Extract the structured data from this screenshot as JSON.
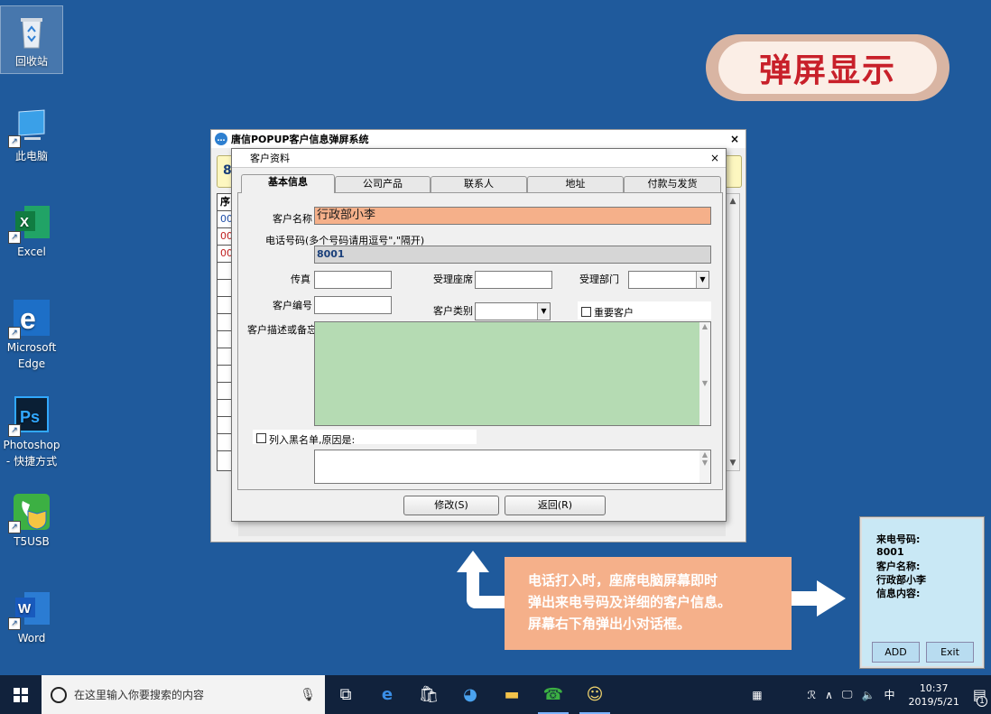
{
  "desktop": {
    "icons": [
      {
        "label": "回收站",
        "icon": "recycle-bin-icon"
      },
      {
        "label": "此电脑",
        "icon": "computer-icon"
      },
      {
        "label": "Excel",
        "icon": "excel-icon"
      },
      {
        "label": "Microsoft Edge",
        "icon": "edge-icon"
      },
      {
        "label": "Photoshop - 快捷方式",
        "icon": "photoshop-icon"
      },
      {
        "label": "T5USB",
        "icon": "phone-app-icon"
      },
      {
        "label": "Word",
        "icon": "word-icon"
      }
    ]
  },
  "banner": {
    "text": "弹屏显示",
    "color": "#c8202a"
  },
  "app_window": {
    "title": "唐信POPUP客户信息弹屏系统",
    "close": "×",
    "caller_prefix": "80",
    "grid_header": "序",
    "grid_rows": [
      "00",
      "00",
      "00"
    ]
  },
  "dialog": {
    "title": "客户资料",
    "close": "×",
    "tabs": [
      "基本信息",
      "公司产品",
      "联系人",
      "地址",
      "付款与发货"
    ],
    "labels": {
      "customer_name": "客户名称",
      "phone": "电话号码(多个号码请用逗号\",\"隔开)",
      "fax": "传真",
      "seat": "受理座席",
      "department": "受理部门",
      "customer_no": "客户编号",
      "customer_type": "客户类别",
      "important": "重要客户",
      "description": "客户描述或备忘",
      "blacklist": "列入黑名单,原因是:"
    },
    "values": {
      "customer_name": "行政部小李",
      "phone": "8001",
      "fax": "",
      "seat": "",
      "department": "",
      "customer_no": "",
      "customer_type": ""
    },
    "buttons": {
      "modify": "修改(S)",
      "back": "返回(R)"
    }
  },
  "popup": {
    "lines": [
      "来电号码:",
      "8001",
      "客户名称:",
      "行政部小李",
      "信息内容:"
    ],
    "add": "ADD",
    "exit": "Exit"
  },
  "callout": {
    "lines": [
      "电话打入时，座席电脑屏幕即时",
      "弹出来电号码及详细的客户信息。",
      "屏幕右下角弹出小对话框。"
    ]
  },
  "taskbar": {
    "search_placeholder": "在这里输入你要搜索的内容",
    "ime": "中",
    "time": "10:37",
    "date": "2019/5/21",
    "notification_count": "1"
  }
}
